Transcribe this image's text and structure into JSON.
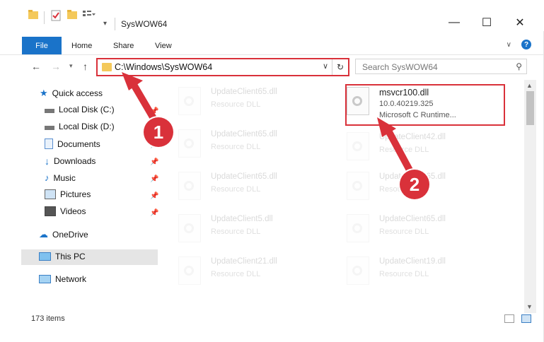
{
  "window": {
    "title": "SysWOW64",
    "controls": [
      "—",
      "☐",
      "✕"
    ]
  },
  "ribbon": {
    "tabs": [
      "File",
      "Home",
      "Share",
      "View"
    ],
    "help": "?"
  },
  "address": {
    "path": "C:\\Windows\\SysWOW64",
    "search_placeholder": "Search SysWOW64"
  },
  "sidebar": {
    "items": [
      {
        "label": "Quick access",
        "icon": "star-icon"
      },
      {
        "label": "Local Disk (C:)",
        "icon": "drive-icon"
      },
      {
        "label": "Local Disk (D:)",
        "icon": "drive-icon"
      },
      {
        "label": "Documents",
        "icon": "documents-icon"
      },
      {
        "label": "Downloads",
        "icon": "downloads-icon"
      },
      {
        "label": "Music",
        "icon": "music-icon"
      },
      {
        "label": "Pictures",
        "icon": "pictures-icon"
      },
      {
        "label": "Videos",
        "icon": "videos-icon"
      },
      {
        "label": "OneDrive",
        "icon": "cloud-icon"
      },
      {
        "label": "This PC",
        "icon": "computer-icon"
      },
      {
        "label": "Network",
        "icon": "network-icon"
      }
    ]
  },
  "files": {
    "highlighted": {
      "name": "msvcr100.dll",
      "version": "10.0.40219.325",
      "description": "Microsoft C Runtime..."
    },
    "left_column": [
      {
        "name": "UpdateClient65.dll",
        "desc": "Resource DLL"
      },
      {
        "name": "UpdateClient65.dll",
        "desc": "Resource DLL"
      },
      {
        "name": "UpdateClient65.dll",
        "desc": "Resource DLL"
      },
      {
        "name": "UpdateClient5.dll",
        "desc": "Resource DLL"
      },
      {
        "name": "UpdateClient21.dll",
        "desc": "Resource DLL"
      }
    ],
    "right_column": [
      {
        "name": "UpdateClient42.dll",
        "desc": "Resource DLL"
      },
      {
        "name": "UpdateClient65.dll",
        "desc": "Resource DLL"
      },
      {
        "name": "UpdateClient65.dll",
        "desc": "Resource DLL"
      },
      {
        "name": "UpdateClient19.dll",
        "desc": "Resource DLL"
      }
    ]
  },
  "status": {
    "count": "173 items"
  },
  "callouts": {
    "one": "1",
    "two": "2"
  },
  "colors": {
    "accent": "#1a73c9",
    "highlight": "#d9313a"
  }
}
